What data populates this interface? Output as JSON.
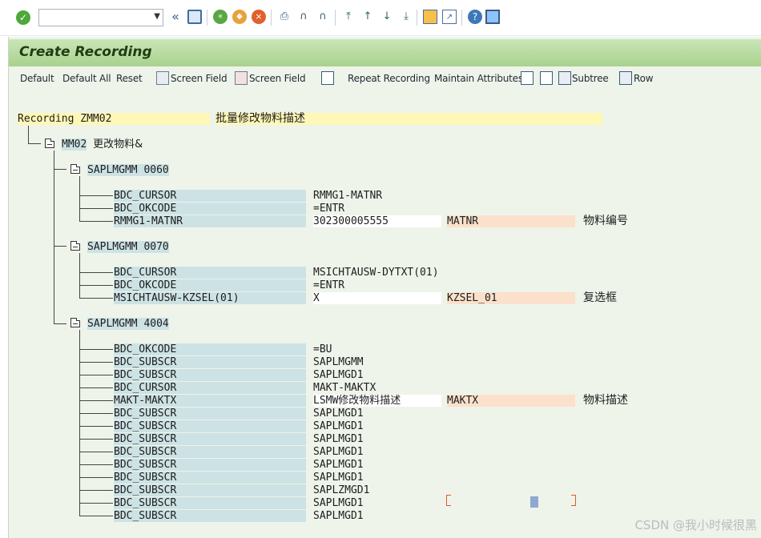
{
  "system_toolbar": {
    "command_field_value": "",
    "icons": [
      "enter-icon",
      "back-icon",
      "save-icon",
      "back-green-icon",
      "exit-icon",
      "cancel-icon",
      "print-icon",
      "find-icon",
      "find-next-icon",
      "first-page-icon",
      "prev-page-icon",
      "next-page-icon",
      "last-page-icon",
      "new-session-icon",
      "shortcut-icon",
      "help-icon",
      "layout-icon"
    ]
  },
  "screen": {
    "title": "Create Recording"
  },
  "app_toolbar": {
    "default": "Default",
    "default_all": "Default All",
    "reset": "Reset",
    "screen_field_add": "Screen Field",
    "screen_field_remove": "Screen Field",
    "repeat_recording": "Repeat Recording",
    "maintain_attributes": "Maintain Attributes",
    "subtree": "Subtree",
    "row": "Row"
  },
  "recording": {
    "header": "Recording ZMM02",
    "description": "批量修改物料描述",
    "transaction_code": "MM02",
    "transaction_text": "更改物料&",
    "screens": [
      {
        "label": "SAPLMGMM 0060",
        "fields": [
          {
            "name": "BDC_CURSOR",
            "value": "RMMG1-MATNR",
            "param": "",
            "desc": ""
          },
          {
            "name": "BDC_OKCODE",
            "value": "=ENTR",
            "param": "",
            "desc": ""
          },
          {
            "name": "RMMG1-MATNR",
            "value": "302300005555",
            "param": "MATNR",
            "desc": "物料编号"
          }
        ]
      },
      {
        "label": "SAPLMGMM 0070",
        "fields": [
          {
            "name": "BDC_CURSOR",
            "value": "MSICHTAUSW-DYTXT(01)",
            "param": "",
            "desc": ""
          },
          {
            "name": "BDC_OKCODE",
            "value": "=ENTR",
            "param": "",
            "desc": ""
          },
          {
            "name": "MSICHTAUSW-KZSEL(01)",
            "value": "X",
            "param": "KZSEL_01",
            "desc": "复选框"
          }
        ]
      },
      {
        "label": "SAPLMGMM 4004",
        "fields": [
          {
            "name": "BDC_OKCODE",
            "value": "=BU",
            "param": "",
            "desc": ""
          },
          {
            "name": "BDC_SUBSCR",
            "value": "SAPLMGMM",
            "param": "",
            "desc": ""
          },
          {
            "name": "BDC_SUBSCR",
            "value": "SAPLMGD1",
            "param": "",
            "desc": ""
          },
          {
            "name": "BDC_CURSOR",
            "value": "MAKT-MAKTX",
            "param": "",
            "desc": ""
          },
          {
            "name": "MAKT-MAKTX",
            "value": "LSMW修改物料描述",
            "param": "MAKTX",
            "desc": "物料描述"
          },
          {
            "name": "BDC_SUBSCR",
            "value": "SAPLMGD1",
            "param": "",
            "desc": ""
          },
          {
            "name": "BDC_SUBSCR",
            "value": "SAPLMGD1",
            "param": "",
            "desc": ""
          },
          {
            "name": "BDC_SUBSCR",
            "value": "SAPLMGD1",
            "param": "",
            "desc": ""
          },
          {
            "name": "BDC_SUBSCR",
            "value": "SAPLMGD1",
            "param": "",
            "desc": ""
          },
          {
            "name": "BDC_SUBSCR",
            "value": "SAPLMGD1",
            "param": "",
            "desc": ""
          },
          {
            "name": "BDC_SUBSCR",
            "value": "SAPLMGD1",
            "param": "",
            "desc": ""
          },
          {
            "name": "BDC_SUBSCR",
            "value": "SAPLZMGD1",
            "param": "",
            "desc": ""
          },
          {
            "name": "BDC_SUBSCR",
            "value": "SAPLMGD1",
            "param": "",
            "desc": ""
          },
          {
            "name": "BDC_SUBSCR",
            "value": "SAPLMGD1",
            "param": "",
            "desc": ""
          }
        ]
      }
    ]
  },
  "watermark": "CSDN @我小时候很黑"
}
